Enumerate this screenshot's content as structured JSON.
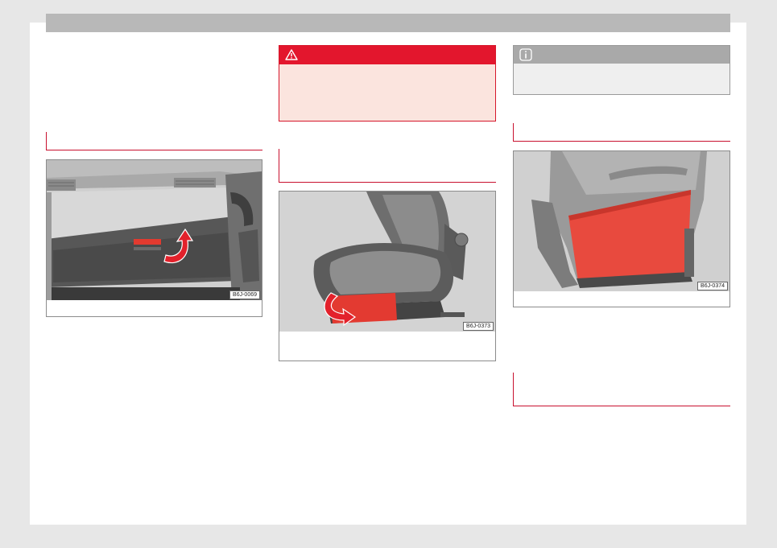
{
  "page": {
    "background_color": "#e7e7e7",
    "paper_color": "#ffffff",
    "header_bar_color": "#b8b8b8",
    "accent_color": "#c8102e"
  },
  "figures": [
    {
      "id": "glovebox",
      "code": "B6J-0069",
      "depicts": "glove box opening with red release handle and arrow"
    },
    {
      "id": "seat-drawer",
      "code": "B6J-0373",
      "depicts": "front seat with red under-seat drawer and arrow"
    },
    {
      "id": "seatback-pocket",
      "code": "B6J-0374",
      "depicts": "seat back with red storage pocket"
    }
  ],
  "warning": {
    "icon": "warning-triangle-icon",
    "header_color": "#e3162d",
    "body_color": "#fbe4de"
  },
  "info": {
    "icon": "info-icon",
    "header_color": "#a9a9a9",
    "body_color": "#efefef"
  }
}
